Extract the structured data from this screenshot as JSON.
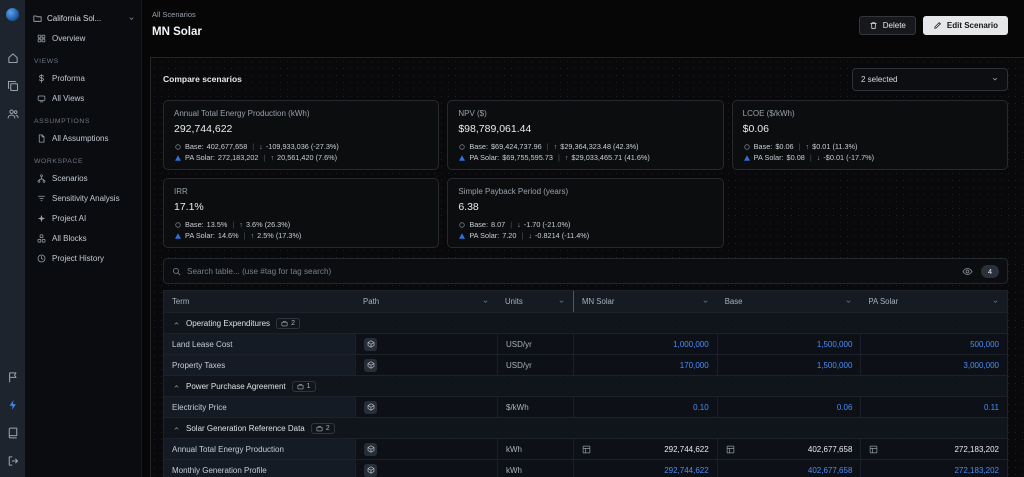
{
  "colors": {
    "accent_blue": "#3f8cf2",
    "link_blue": "#4a8cf7",
    "base_marker": "#717a86",
    "pa_marker": "#2f6fe0"
  },
  "rail": {
    "icons": [
      "home",
      "windows",
      "users"
    ],
    "bottom_icons": [
      "flag",
      "zap",
      "book",
      "logout"
    ]
  },
  "sidebar": {
    "project_label": "California Sol...",
    "overview_label": "Overview",
    "sections": [
      {
        "title": "VIEWS",
        "items": [
          "Proforma",
          "All Views"
        ]
      },
      {
        "title": "ASSUMPTIONS",
        "items": [
          "All Assumptions"
        ]
      },
      {
        "title": "WORKSPACE",
        "items": [
          "Scenarios",
          "Sensitivity Analysis",
          "Project AI",
          "All Blocks",
          "Project History"
        ]
      }
    ]
  },
  "header": {
    "breadcrumb": "All Scenarios",
    "title": "MN Solar",
    "delete_label": "Delete",
    "edit_label": "Edit Scenario"
  },
  "compare": {
    "label": "Compare scenarios",
    "selected": "2 selected"
  },
  "cards": [
    {
      "title": "Annual Total Energy Production (kWh)",
      "value": "292,744,622",
      "rows": [
        {
          "name": "Base:",
          "value": "402,677,658",
          "arrow": "↓",
          "delta": "-109,933,036 (-27.3%)"
        },
        {
          "name": "PA Solar:",
          "value": "272,183,202",
          "arrow": "↑",
          "delta": "20,561,420 (7.6%)"
        }
      ]
    },
    {
      "title": "NPV ($)",
      "value": "$98,789,061.44",
      "rows": [
        {
          "name": "Base:",
          "value": "$69,424,737.96",
          "arrow": "↑",
          "delta": "$29,364,323.48 (42.3%)"
        },
        {
          "name": "PA Solar:",
          "value": "$69,755,595.73",
          "arrow": "↑",
          "delta": "$29,033,465.71 (41.6%)"
        }
      ]
    },
    {
      "title": "LCOE ($/kWh)",
      "value": "$0.06",
      "rows": [
        {
          "name": "Base:",
          "value": "$0.06",
          "arrow": "↑",
          "delta": "$0.01 (11.3%)"
        },
        {
          "name": "PA Solar:",
          "value": "$0.08",
          "arrow": "↓",
          "delta": "-$0.01 (-17.7%)"
        }
      ]
    },
    {
      "title": "IRR",
      "value": "17.1%",
      "rows": [
        {
          "name": "Base:",
          "value": "13.5%",
          "arrow": "↑",
          "delta": "3.6% (26.3%)"
        },
        {
          "name": "PA Solar:",
          "value": "14.6%",
          "arrow": "↑",
          "delta": "2.5% (17.3%)"
        }
      ]
    },
    {
      "title": "Simple Payback Period (years)",
      "value": "6.38",
      "rows": [
        {
          "name": "Base:",
          "value": "8.07",
          "arrow": "↓",
          "delta": "-1.70 (-21.0%)"
        },
        {
          "name": "PA Solar:",
          "value": "7.20",
          "arrow": "↓",
          "delta": "-0.8214 (-11.4%)"
        }
      ]
    }
  ],
  "search": {
    "placeholder": "Search table... (use #tag for tag search)",
    "visible_count": "4"
  },
  "table": {
    "columns": [
      "Term",
      "Path",
      "Units",
      "MN Solar",
      "Base",
      "PA Solar"
    ],
    "groups": [
      {
        "label": "Operating Expenditures",
        "count": "2",
        "rows": [
          {
            "term": "Land Lease Cost",
            "units": "USD/yr",
            "mn": "1,000,000",
            "base": "1,500,000",
            "pa": "500,000"
          },
          {
            "term": "Property Taxes",
            "units": "USD/yr",
            "mn": "170,000",
            "base": "1,500,000",
            "pa": "3,000,000"
          }
        ]
      },
      {
        "label": "Power Purchase Agreement",
        "count": "1",
        "rows": [
          {
            "term": "Electricity Price",
            "units": "$/kWh",
            "mn": "0.10",
            "base": "0.06",
            "pa": "0.11"
          }
        ]
      },
      {
        "label": "Solar Generation Reference Data",
        "count": "2",
        "rows": [
          {
            "term": "Annual Total Energy Production",
            "units": "kWh",
            "mn": "292,744,622",
            "base": "402,677,658",
            "pa": "272,183,202"
          },
          {
            "term": "Monthly Generation Profile",
            "units": "kWh",
            "mn": "292,744,622",
            "base": "402,677,658",
            "pa": "272,183,202"
          }
        ]
      }
    ]
  }
}
